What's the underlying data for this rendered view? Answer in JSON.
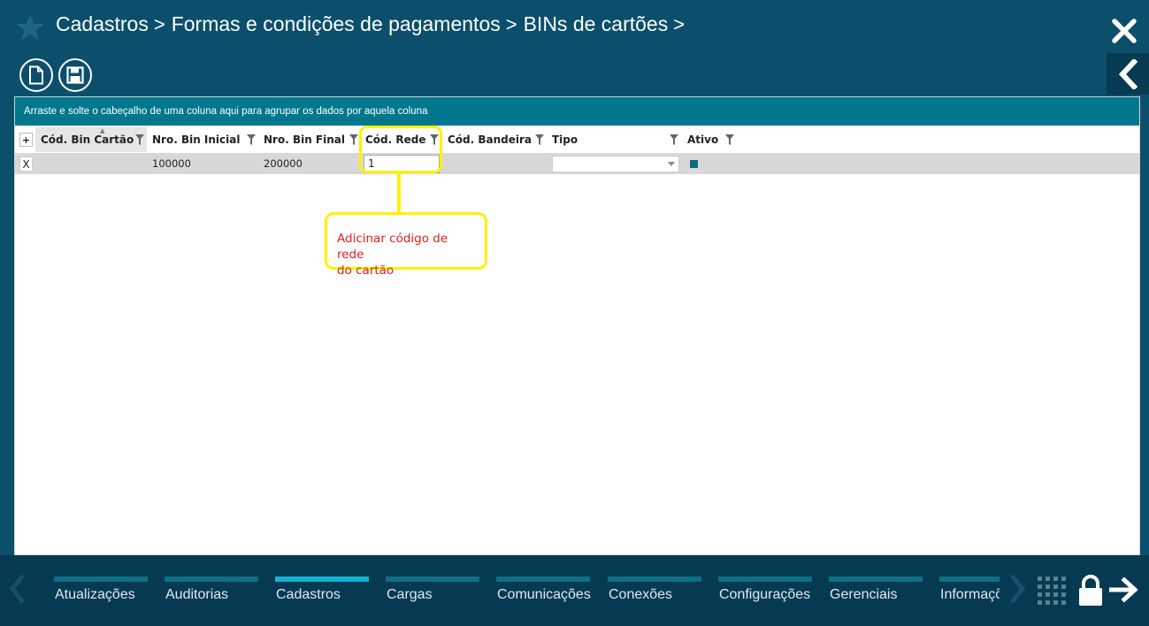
{
  "header": {
    "breadcrumb": [
      "Cadastros",
      "Formas e condições de pagamentos",
      "BINs de cartões"
    ],
    "separator": ">"
  },
  "grid": {
    "group_hint": "Arraste e solte o cabeçalho de uma coluna aqui para agrupar os dados por aquela coluna",
    "add_label": "+",
    "columns": [
      "Cód. Bin Cartão",
      "Nro. Bin Inicial",
      "Nro. Bin Final",
      "Cód. Rede",
      "Cód. Bandeira",
      "Tipo",
      "Ativo"
    ],
    "rows": [
      {
        "delete_label": "X",
        "cod_bin": "",
        "bin_inicial": "100000",
        "bin_final": "200000",
        "cod_rede": "1",
        "cod_bandeira": "",
        "tipo": "",
        "ativo": true
      }
    ]
  },
  "annotation": {
    "text_line1": "Adicinar código de rede",
    "text_line2": "do cartão"
  },
  "bottom_nav": {
    "items": [
      "Atualizações",
      "Auditorias",
      "Cadastros",
      "Cargas",
      "Comunicações",
      "Conexões",
      "Configurações",
      "Gerenciais",
      "Informações"
    ],
    "active": "Cadastros"
  },
  "colors": {
    "background": "#0b4f6c",
    "group_bar": "#00778c",
    "nav_active": "#14b3d1",
    "highlight": "#fff000",
    "annotation_text": "#e0201f"
  }
}
